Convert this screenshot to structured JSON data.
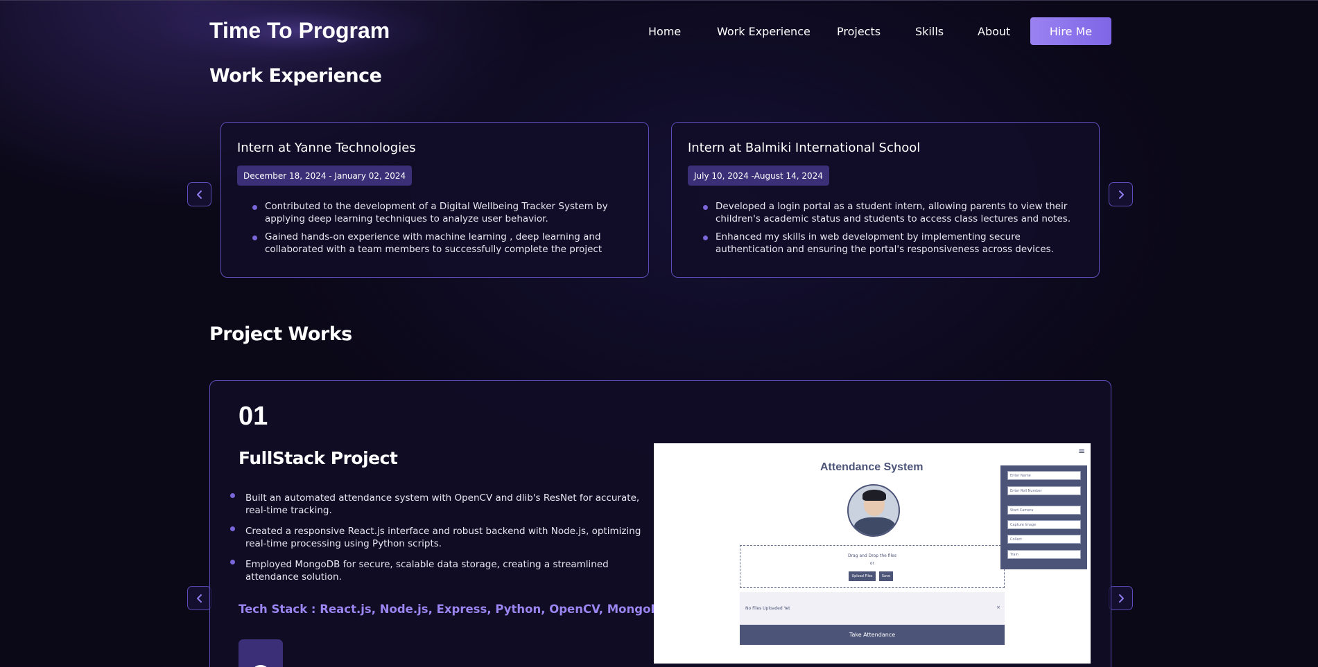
{
  "header": {
    "brand": "Time To Program",
    "nav": [
      "Home",
      "Work Experience",
      "Projects",
      "Skills",
      "About"
    ],
    "cta": "Hire Me"
  },
  "experience": {
    "title": "Work Experience",
    "cards": [
      {
        "role": "Intern at Yanne Technologies",
        "dates": "December 18, 2024 - January 02, 2024",
        "bullets": [
          "Contributed to the development of a Digital Wellbeing Tracker System by applying deep learning techniques to analyze user behavior.",
          "Gained hands-on experience with machine learning , deep learning and collaborated with a team members to successfully complete the project"
        ]
      },
      {
        "role": "Intern at Balmiki International School",
        "dates": "July 10, 2024 -August 14, 2024",
        "bullets": [
          "Developed a login portal as a student intern, allowing parents to view their children's academic status and students to access class lectures and notes.",
          "Enhanced my skills in web development by implementing secure authentication and ensuring the portal's responsiveness across devices."
        ]
      }
    ]
  },
  "projects": {
    "title": "Project Works",
    "items": [
      {
        "number": "01",
        "name": "FullStack Project",
        "bullets": [
          "Built an automated attendance system with OpenCV and dlib's ResNet for accurate, real-time tracking.",
          "Created a responsive React.js interface and robust backend with Node.js, optimizing real-time processing using Python scripts.",
          "Employed MongoDB for secure, scalable data storage, creating a streamlined attendance solution."
        ],
        "tech_stack": "Tech Stack : React.js, Node.js, Express, Python, OpenCV, MongoDB",
        "screenshot": {
          "title": "Attendance System",
          "drop_text": "Drag and Drop the files",
          "or_text": "or",
          "upload_label": "Upload Files",
          "save_label": "Save",
          "no_files": "No Files Uploaded Yet",
          "close": "×",
          "take_attendance": "Take Attendance",
          "menu": "≡",
          "side_fields": [
            "Enter Name",
            "Enter Roll Number",
            "Start Camera",
            "Capture Image",
            "Collect",
            "Train"
          ]
        }
      }
    ]
  },
  "icons": {
    "prev": "chevron-left-icon",
    "next": "chevron-right-icon",
    "github": "github-icon"
  },
  "colors": {
    "background": "#0b0818",
    "accent": "#8f7cf0",
    "card_border": "#5b4eb8",
    "badge": "#3b2f78",
    "tech_text": "#9b85f0"
  }
}
